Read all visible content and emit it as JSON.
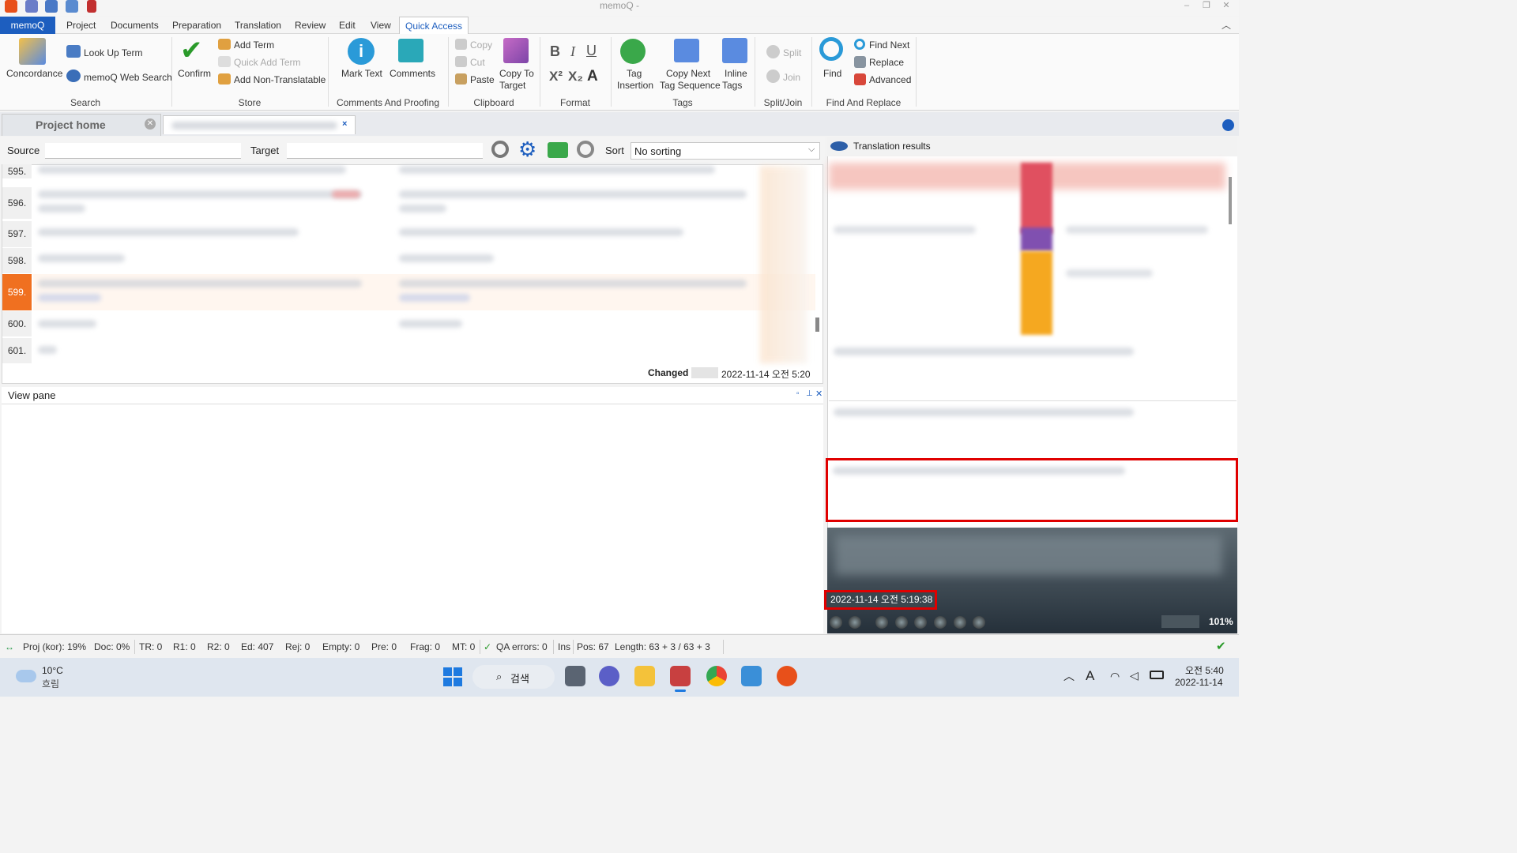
{
  "window": {
    "title": "memoQ -"
  },
  "menu": [
    "memoQ",
    "Project",
    "Documents",
    "Preparation",
    "Translation",
    "Review",
    "Edit",
    "View",
    "Quick Access"
  ],
  "ribbon": {
    "search": {
      "concordance": "Concordance",
      "lookup": "Look Up Term",
      "websearch": "memoQ Web Search",
      "group": "Search"
    },
    "store": {
      "confirm": "Confirm",
      "addterm": "Add Term",
      "quickadd": "Quick Add Term",
      "addnon": "Add Non-Translatable",
      "group": "Store"
    },
    "comments": {
      "mark": "Mark Text",
      "comments": "Comments",
      "group": "Comments And Proofing"
    },
    "clipboard": {
      "copy": "Copy",
      "cut": "Cut",
      "paste": "Paste",
      "copyto": "Copy To",
      "target": "Target",
      "group": "Clipboard"
    },
    "format": {
      "group": "Format"
    },
    "tags": {
      "tag": "Tag",
      "insertion": "Insertion",
      "copynext": "Copy Next",
      "tagseq": "Tag Sequence",
      "inline": "Inline",
      "inlinetags": "Tags",
      "group": "Tags"
    },
    "split": {
      "split": "Split",
      "join": "Join",
      "group": "Split/Join"
    },
    "find": {
      "find": "Find",
      "findnext": "Find Next",
      "replace": "Replace",
      "advanced": "Advanced",
      "group": "Find And Replace"
    }
  },
  "tabs": {
    "home": "Project home"
  },
  "filter": {
    "source": "Source",
    "target": "Target",
    "sort": "Sort",
    "sort_value": "No sorting"
  },
  "rows": [
    "595.",
    "596.",
    "597.",
    "598.",
    "599.",
    "600.",
    "601."
  ],
  "grid_footer": {
    "changed": "Changed",
    "date": "2022-11-14 오전 5:20"
  },
  "viewpane": {
    "title": "View pane"
  },
  "translation_results": {
    "title": "Translation results",
    "timestamp": "2022-11-14 오전 5:19:38",
    "zoom": "101%"
  },
  "status": {
    "proj": "Proj (kor): 19%",
    "doc": "Doc: 0%",
    "tr": "TR: 0",
    "r1": "R1: 0",
    "r2": "R2: 0",
    "ed": "Ed: 407",
    "rej": "Rej: 0",
    "empty": "Empty: 0",
    "pre": "Pre: 0",
    "frag": "Frag: 0",
    "mt": "MT: 0",
    "qa": "QA errors: 0",
    "ins": "Ins",
    "pos": "Pos: 67",
    "length": "Length: 63 + 3 / 63 + 3"
  },
  "taskbar": {
    "temp": "10°C",
    "weather": "흐림",
    "search": "검색",
    "time": "오전 5:40",
    "date": "2022-11-14"
  }
}
